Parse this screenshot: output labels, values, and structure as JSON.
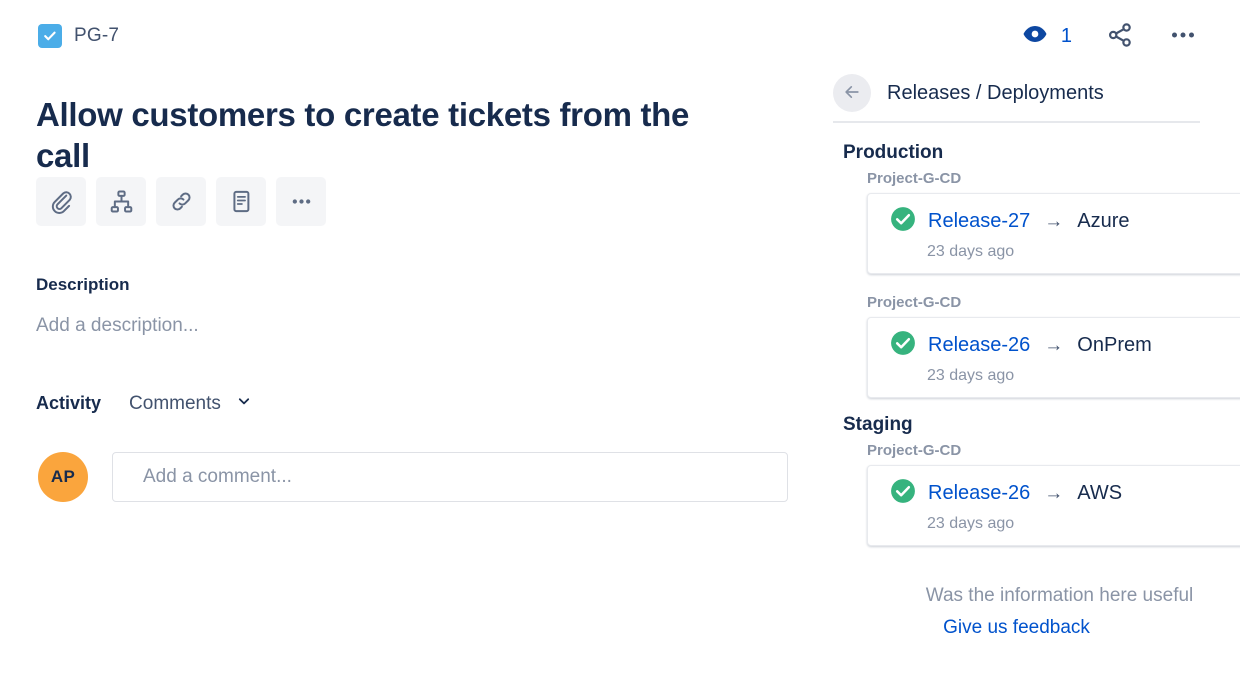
{
  "issue": {
    "key": "PG-7",
    "type_icon": "task-checkbox-icon",
    "title": "Allow customers to create tickets from the call",
    "toolbar": [
      {
        "name": "attach-button",
        "icon": "paperclip-icon",
        "label": "Attach"
      },
      {
        "name": "add-child-issue-button",
        "icon": "hierarchy-icon",
        "label": "Add a child issue"
      },
      {
        "name": "link-issue-button",
        "icon": "link-icon",
        "label": "Link issue"
      },
      {
        "name": "add-page-button",
        "icon": "document-icon",
        "label": "Add a page"
      },
      {
        "name": "more-options-button",
        "icon": "ellipsis-icon",
        "label": "More"
      }
    ],
    "description": {
      "heading": "Description",
      "placeholder": "Add a description..."
    },
    "activity": {
      "label": "Activity",
      "filter_selected": "Comments",
      "chevron_icon": "chevron-down-icon"
    },
    "comment": {
      "avatar_initials": "AP",
      "placeholder": "Add a comment..."
    }
  },
  "header_actions": {
    "watch_icon": "eye-icon",
    "watch_count": "1",
    "share_icon": "share-icon",
    "more_icon": "ellipsis-icon"
  },
  "releases_panel": {
    "back_icon": "arrow-left-icon",
    "title": "Releases / Deployments",
    "groups": [
      {
        "environment": "Production",
        "deployments": [
          {
            "pipeline": "Project-G-CD",
            "status_icon": "check-circle-icon",
            "release": "Release-27",
            "arrow": "→",
            "target": "Azure",
            "time": "23 days ago"
          },
          {
            "pipeline": "Project-G-CD",
            "status_icon": "check-circle-icon",
            "release": "Release-26",
            "arrow": "→",
            "target": "OnPrem",
            "time": "23 days ago"
          }
        ]
      },
      {
        "environment": "Staging",
        "deployments": [
          {
            "pipeline": "Project-G-CD",
            "status_icon": "check-circle-icon",
            "release": "Release-26",
            "arrow": "→",
            "target": "AWS",
            "time": "23 days ago"
          }
        ]
      }
    ],
    "feedback": {
      "question": "Was the information here useful",
      "link": "Give us feedback"
    }
  },
  "colors": {
    "link": "#0052CC",
    "issue_type": "#4BADE8",
    "success": "#36B37E",
    "avatar": "#FAA53D",
    "text": "#172B4D",
    "subtle_text": "#8A94A6"
  }
}
